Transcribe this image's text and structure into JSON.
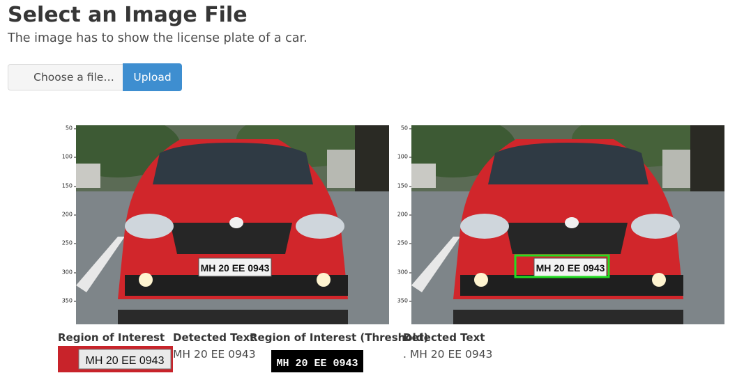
{
  "page": {
    "title": "Select an Image File",
    "subtitle": "The image has to show the license plate of a car."
  },
  "upload_form": {
    "choose_label": "Choose a file…",
    "upload_label": "Upload"
  },
  "plots": {
    "y_ticks": [
      "50",
      "100",
      "150",
      "200",
      "250",
      "300",
      "350"
    ],
    "plate_text": "MH 20  EE  0943"
  },
  "results": {
    "roi_caption": "Region of Interest",
    "roi_text_caption": "Detected Text",
    "roi_text_value": "MH 20 EE 0943",
    "roi_threshold_caption": "Region of Interest (Threshold)",
    "threshold_text_caption": "Detected Text",
    "threshold_text_value": ". MH 20 EE 0943"
  },
  "colors": {
    "car_red": "#d1262b",
    "detection_box": "#22dd22",
    "upload_button": "#3e8ed0"
  }
}
